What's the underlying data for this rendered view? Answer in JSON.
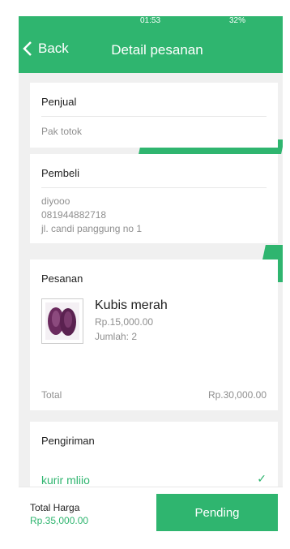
{
  "statusbar": {
    "time": "01:53",
    "battery": "32%"
  },
  "header": {
    "back_label": "Back",
    "title": "Detail pesanan"
  },
  "seller": {
    "title": "Penjual",
    "name": "Pak totok"
  },
  "buyer": {
    "title": "Pembeli",
    "name": "diyooo",
    "phone": "081944882718",
    "address": "jl. candi panggung no 1"
  },
  "order": {
    "title": "Pesanan",
    "product": {
      "name": "Kubis merah",
      "price": "Rp.15,000.00",
      "qty": "Jumlah: 2"
    },
    "total_label": "Total",
    "total_value": "Rp.30,000.00"
  },
  "shipping": {
    "title": "Pengiriman",
    "courier": "kurir mliio"
  },
  "footer": {
    "total_label": "Total Harga",
    "total_value": "Rp.35,000.00",
    "button_label": "Pending"
  },
  "colors": {
    "accent": "#2fb56f"
  }
}
